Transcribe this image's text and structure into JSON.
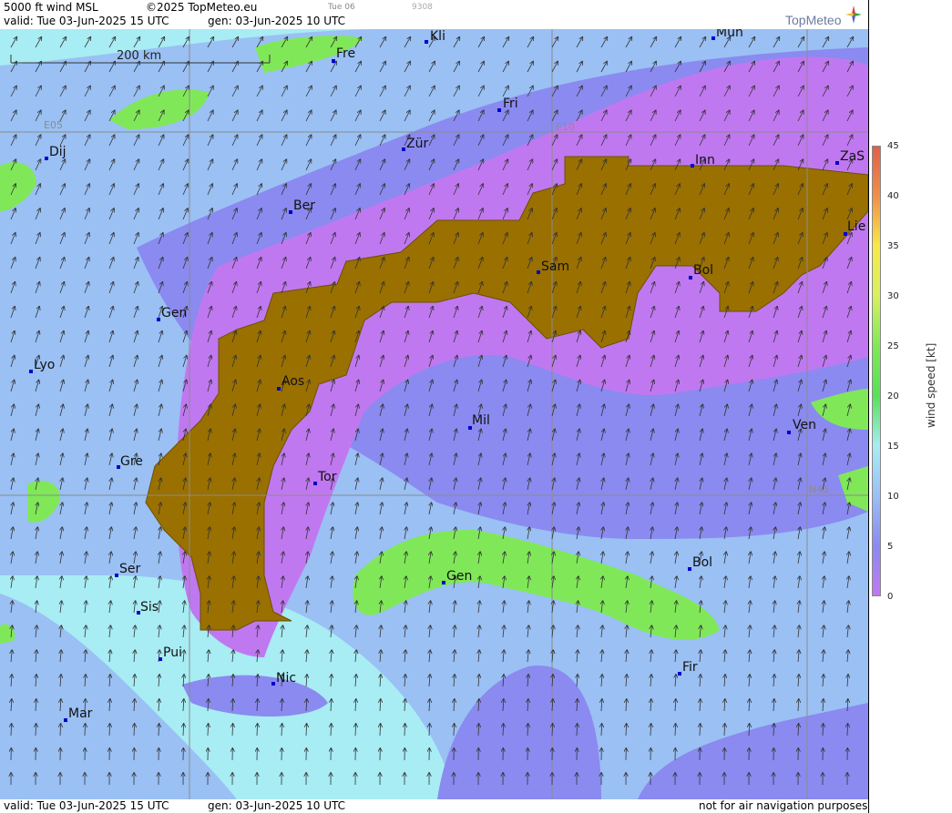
{
  "header": {
    "product": "5000 ft wind MSL",
    "copyright": "©2025 TopMeteo.eu",
    "tab_day": "Tue 06",
    "tab_code": "9308",
    "valid_line": "valid:  Tue  03-Jun-2025  15 UTC",
    "gen_line": "gen: 03-Jun-2025 10 UTC",
    "logo": "TopMeteo"
  },
  "footer": {
    "valid_line": "valid:  Tue  03-Jun-2025  15 UTC",
    "gen_line": "gen: 03-Jun-2025 10 UTC",
    "disclaimer": "not for air navigation purposes"
  },
  "scale_bar": "200 km",
  "grid_labels": [
    "E05",
    "E10",
    "N45"
  ],
  "cities": [
    "Kli",
    "Mün",
    "Fre",
    "Fri",
    "Dij",
    "Zür",
    "Inn",
    "ZaS",
    "Ber",
    "Lie",
    "Sam",
    "Bol",
    "Gen",
    "Lyo",
    "Aos",
    "Mil",
    "Ven",
    "Gre",
    "Tor",
    "Ser",
    "Gen",
    "Bol",
    "Sis",
    "Pui",
    "Fir",
    "Nic",
    "Mar"
  ],
  "legend": {
    "title": "wind speed [kt]",
    "ticks": [
      "45",
      "40",
      "35",
      "30",
      "25",
      "20",
      "15",
      "10",
      "5",
      "0"
    ],
    "colors": [
      "#e06048",
      "#f09048",
      "#f8e848",
      "#d8f060",
      "#80e858",
      "#58e058",
      "#a8ecf4",
      "#9ac0f4",
      "#8a8af0",
      "#c078f0"
    ]
  },
  "colors": {
    "terrain": "#9a7000",
    "light_blue": "#a8ecf4",
    "mid_blue": "#9ac0f4",
    "blue_purple": "#8a8af0",
    "purple": "#c078f0",
    "green": "#80e858"
  }
}
